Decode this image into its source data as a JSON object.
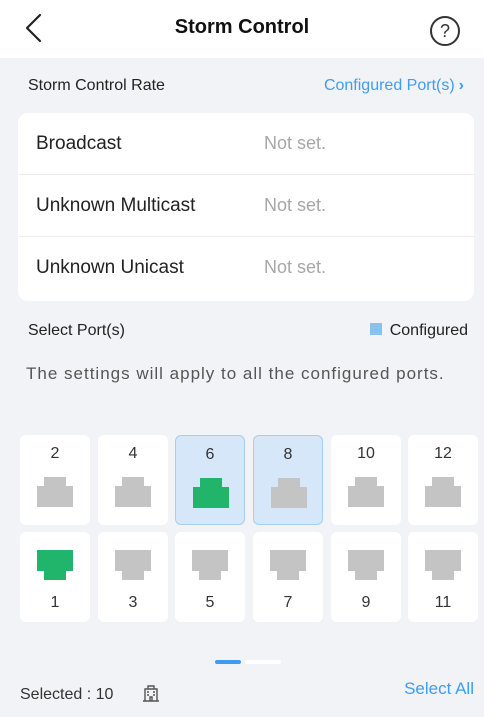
{
  "header": {
    "title": "Storm Control"
  },
  "rate": {
    "heading": "Storm Control Rate",
    "configured_link": "Configured Port(s)",
    "rows": [
      {
        "label": "Broadcast",
        "value": "Not set."
      },
      {
        "label": "Unknown Multicast",
        "value": "Not set."
      },
      {
        "label": "Unknown Unicast",
        "value": "Not set."
      }
    ]
  },
  "ports": {
    "heading": "Select Port(s)",
    "legend_label": "Configured",
    "note": "The settings will apply to all the configured ports.",
    "top_row": [
      {
        "number": "2",
        "selected": false,
        "active": false
      },
      {
        "number": "4",
        "selected": false,
        "active": false
      },
      {
        "number": "6",
        "selected": true,
        "active": true
      },
      {
        "number": "8",
        "selected": true,
        "active": false
      },
      {
        "number": "10",
        "selected": false,
        "active": false
      },
      {
        "number": "12",
        "selected": false,
        "active": false
      }
    ],
    "bottom_row": [
      {
        "number": "1",
        "selected": false,
        "active": true
      },
      {
        "number": "3",
        "selected": false,
        "active": false
      },
      {
        "number": "5",
        "selected": false,
        "active": false
      },
      {
        "number": "7",
        "selected": false,
        "active": false
      },
      {
        "number": "9",
        "selected": false,
        "active": false
      },
      {
        "number": "11",
        "selected": false,
        "active": false
      }
    ]
  },
  "footer": {
    "selected_text": "Selected : 10",
    "select_all": "Select All"
  },
  "colors": {
    "accent": "#3d9df2",
    "port_active": "#21b56b",
    "port_idle": "#c4c4c4",
    "configured": "#87c3f2"
  }
}
